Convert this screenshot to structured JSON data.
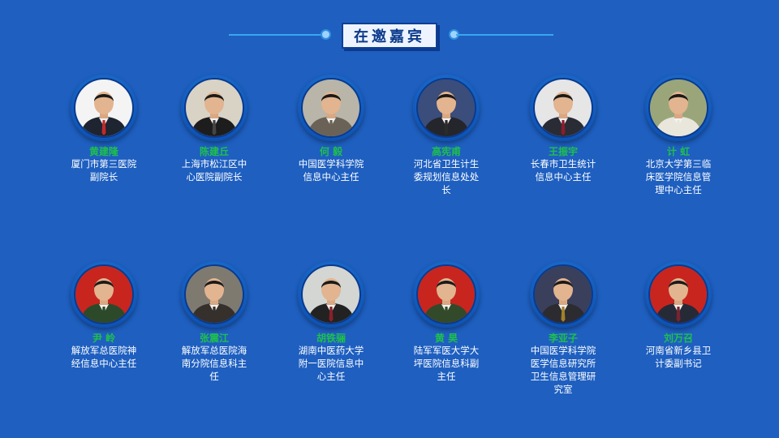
{
  "header": {
    "title": "在邀嘉宾"
  },
  "guests_row1": [
    {
      "name": "黄建隆",
      "title": "厦门市第三医院副院长",
      "bg": "#f4f4f4",
      "shirt": "#1e2430",
      "tie": "#c02a2a"
    },
    {
      "name": "陈建丘",
      "title": "上海市松江区中心医院副院长",
      "bg": "#d9d3c6",
      "shirt": "#1d1d1d",
      "tie": "#444444"
    },
    {
      "name": "何  毅",
      "title": "中国医学科学院信息中心主任",
      "bg": "#b9b5a8",
      "shirt": "#6a6256",
      "tie": "#6a6256"
    },
    {
      "name": "高宪甫",
      "title": "河北省卫生计生委规划信息处处长",
      "bg": "#3b4d7a",
      "shirt": "#24262c",
      "tie": "#2b2b2b"
    },
    {
      "name": "王振宇",
      "title": "长春市卫生统计信息中心主任",
      "bg": "#e6e6e6",
      "shirt": "#2a2c35",
      "tie": "#8b1c2c"
    },
    {
      "name": "计  虹",
      "title": "北京大学第三临床医学院信息管理中心主任",
      "bg": "#9aa67a",
      "shirt": "#e9e6dc",
      "tie": "#e9e6dc"
    }
  ],
  "guests_row2": [
    {
      "name": "尹  岭",
      "title": "解放军总医院神经信息中心主任",
      "bg": "#c8251f",
      "shirt": "#2c4a2a",
      "tie": "#2c4a2a"
    },
    {
      "name": "张震江",
      "title": "解放军总医院海南分院信息科主任",
      "bg": "#7f7a70",
      "shirt": "#35302c",
      "tie": "#35302c"
    },
    {
      "name": "胡铁骊",
      "title": "湖南中医药大学附一医院信息中心主任",
      "bg": "#d3d6d2",
      "shirt": "#222222",
      "tie": "#8a1f2a"
    },
    {
      "name": "黄  昊",
      "title": "陆军军医大学大坪医院信息科副主任",
      "bg": "#c8251f",
      "shirt": "#334a2a",
      "tie": "#334a2a"
    },
    {
      "name": "李亚子",
      "title": "中国医学科学院医学信息研究所卫生信息管理研究室",
      "bg": "#3a3f5c",
      "shirt": "#2b2b30",
      "tie": "#a0802a"
    },
    {
      "name": "刘万召",
      "title": "河南省新乡县卫计委副书记",
      "bg": "#c8251f",
      "shirt": "#262a36",
      "tie": "#7a2330"
    }
  ]
}
